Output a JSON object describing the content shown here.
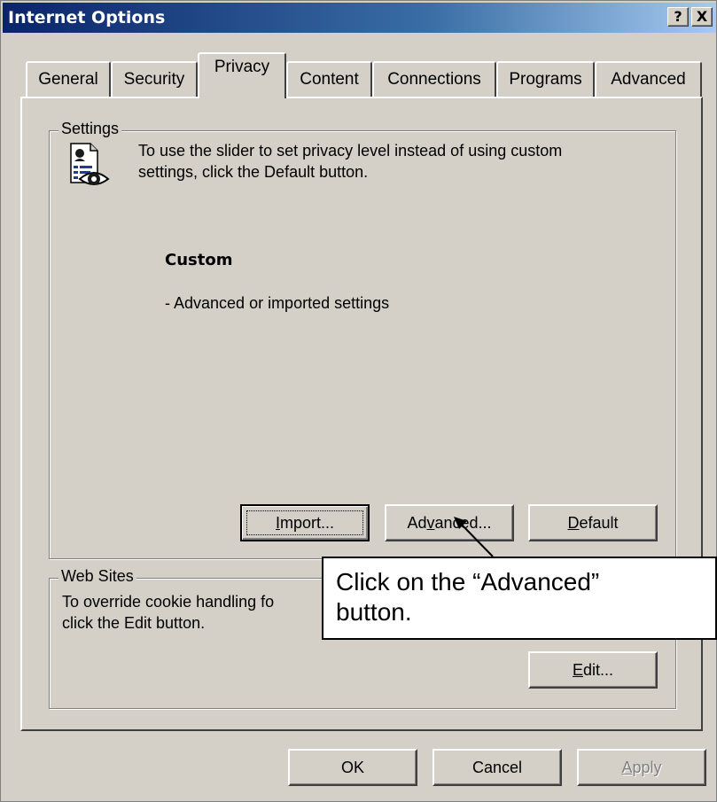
{
  "window": {
    "title": "Internet Options",
    "help_label": "?",
    "close_label": "X"
  },
  "tabs": [
    {
      "label": "General"
    },
    {
      "label": "Security"
    },
    {
      "label": "Privacy"
    },
    {
      "label": "Content"
    },
    {
      "label": "Connections"
    },
    {
      "label": "Programs"
    },
    {
      "label": "Advanced"
    }
  ],
  "active_tab": "Privacy",
  "settings_group": {
    "label": "Settings",
    "icon": "privacy-document-eye-icon",
    "description_line1": "To use the slider to set privacy level instead of using custom",
    "description_line2": "settings, click the Default button.",
    "level_name": "Custom",
    "level_desc": "- Advanced or imported settings",
    "buttons": {
      "import": {
        "pre": "",
        "accel": "I",
        "post": "mport..."
      },
      "advanced": {
        "pre": "Ad",
        "accel": "v",
        "post": "anced..."
      },
      "default": {
        "pre": "",
        "accel": "D",
        "post": "efault"
      }
    }
  },
  "websites_group": {
    "label": "Web Sites",
    "description_line1": "To override cookie handling fo",
    "description_line2": "click the Edit button.",
    "edit_button": {
      "pre": "",
      "accel": "E",
      "post": "dit..."
    }
  },
  "footer": {
    "ok": "OK",
    "cancel": "Cancel",
    "apply": {
      "pre": "",
      "accel": "A",
      "post": "pply"
    }
  },
  "callout": {
    "line1": "Click on the “Advanced”",
    "line2": "button."
  }
}
